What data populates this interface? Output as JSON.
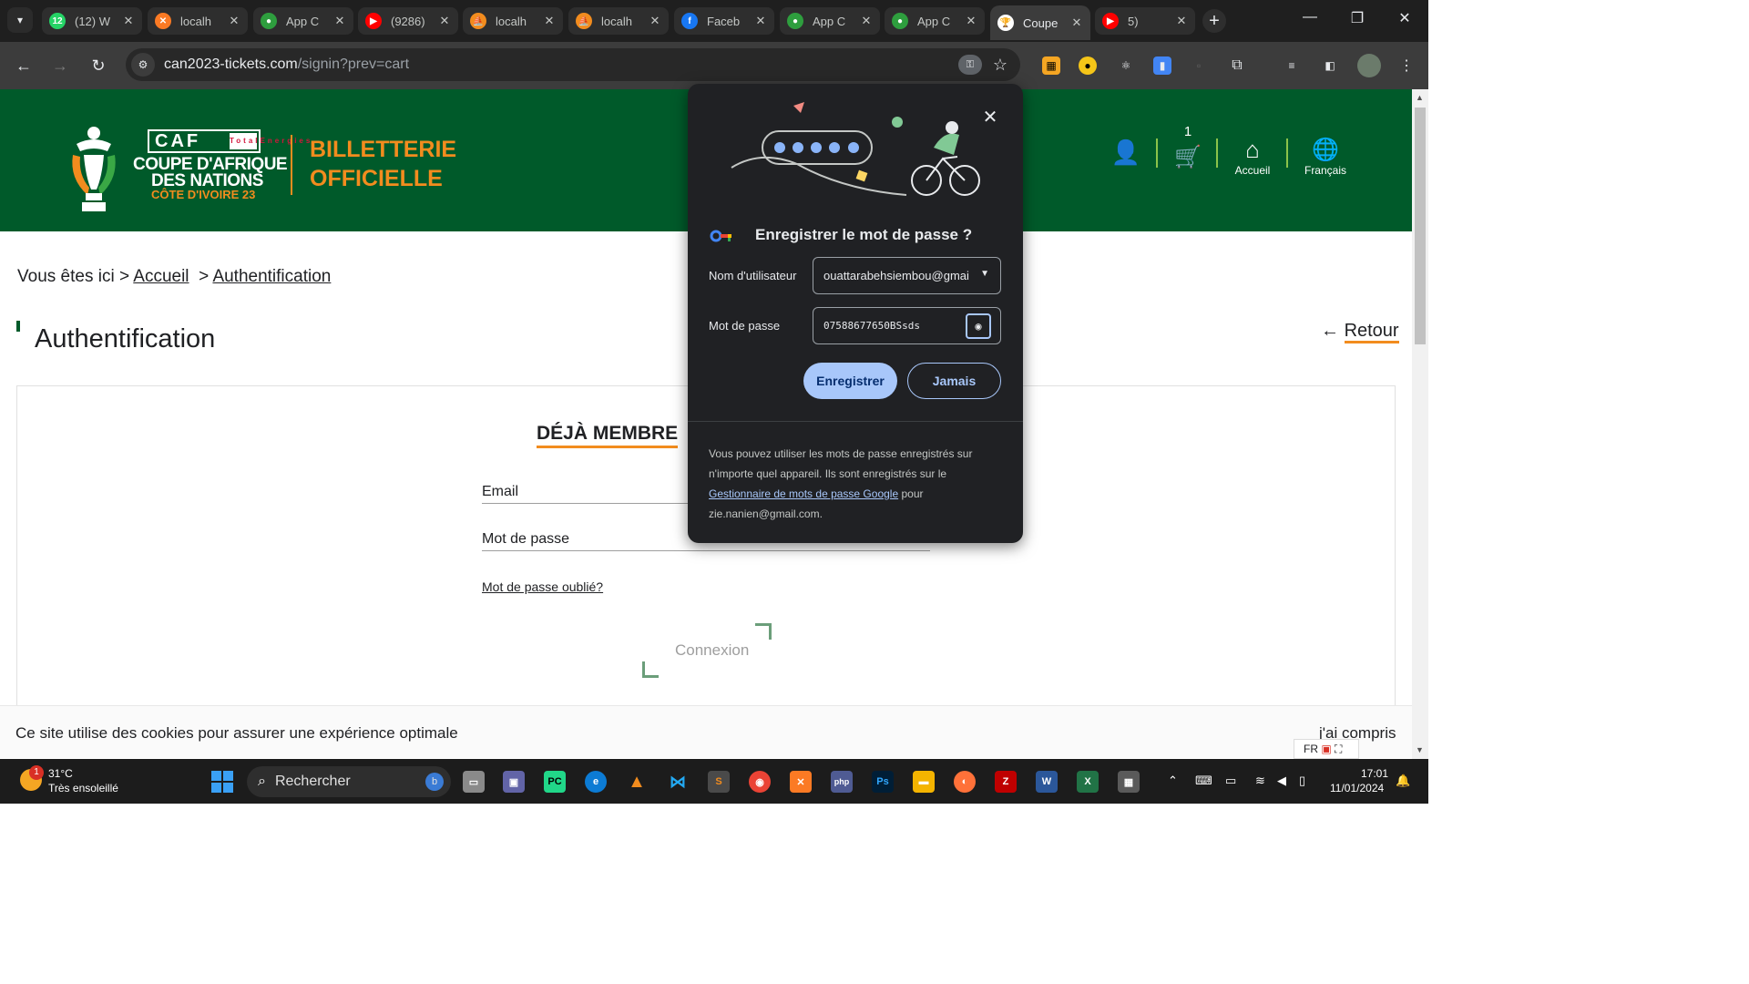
{
  "browser": {
    "tabs": [
      {
        "title": "(12) W",
        "favicon": "whatsapp-icon",
        "color": "#25d366",
        "glyph": "12"
      },
      {
        "title": "localh",
        "favicon": "xampp-icon",
        "color": "#fb7a24",
        "glyph": "✕"
      },
      {
        "title": "App C",
        "favicon": "app-globe-icon",
        "color": "#2e9e3e",
        "glyph": "●"
      },
      {
        "title": "(9286)",
        "favicon": "youtube-icon",
        "color": "#ff0000",
        "glyph": "▶"
      },
      {
        "title": "localh",
        "favicon": "sail-icon",
        "color": "#f28c1e",
        "glyph": "⛵"
      },
      {
        "title": "localh",
        "favicon": "sail-icon",
        "color": "#f28c1e",
        "glyph": "⛵"
      },
      {
        "title": "Faceb",
        "favicon": "facebook-icon",
        "color": "#1877f2",
        "glyph": "f"
      },
      {
        "title": "App C",
        "favicon": "app-globe-icon",
        "color": "#2e9e3e",
        "glyph": "●"
      },
      {
        "title": "App C",
        "favicon": "app-globe-icon",
        "color": "#2e9e3e",
        "glyph": "●"
      },
      {
        "title": "Coupe",
        "favicon": "can-trophy-icon",
        "color": "#ffffff",
        "glyph": "🏆"
      },
      {
        "title": "5)",
        "favicon": "youtube-icon",
        "color": "#ff0000",
        "glyph": "▶"
      }
    ],
    "active_tab_index": 9,
    "url_host": "can2023-tickets.com",
    "url_path": "/signin?prev=cart"
  },
  "header": {
    "caf": "CAF",
    "sponsor": "TotalEnergies",
    "logo_line1": "COUPE D'AFRIQUE",
    "logo_line2": "DES NATIONS",
    "logo_line3": "CÔTE D'IVOIRE 23",
    "billet_line1": "BILLETTERIE",
    "billet_line2": "OFFICIELLE",
    "cart_count": "1",
    "home_label": "Accueil",
    "lang_label": "Français"
  },
  "page": {
    "breadcrumb_prefix": "Vous êtes ici >",
    "breadcrumb_home": "Accueil",
    "breadcrumb_sep": ">",
    "breadcrumb_current": "Authentification",
    "title": "Authentification",
    "back": "Retour",
    "section_title": "DÉJÀ MEMBRE",
    "email_label": "Email",
    "password_label": "Mot de passe",
    "forgot": "Mot de passe oublié?",
    "login": "Connexion"
  },
  "cookie": {
    "message": "Ce site utilise des cookies pour assurer une expérience optimale",
    "accept": "j'ai compris",
    "lang_badge": "FR"
  },
  "password_popup": {
    "title": "Enregistrer le mot de passe ?",
    "username_label": "Nom d'utilisateur",
    "username_value": "ouattarabehsiembou@gmai",
    "password_label": "Mot de passe",
    "password_value": "07588677650BSsds",
    "save": "Enregistrer",
    "never": "Jamais",
    "footer_text1": "Vous pouvez utiliser les mots de passe enregistrés sur n'importe quel appareil. Ils sont enregistrés sur le",
    "footer_link": "Gestionnaire de mots de passe Google",
    "footer_text2": "pour zie.nanien@gmail.com."
  },
  "taskbar": {
    "weather_badge": "1",
    "temperature": "31°C",
    "weather": "Très ensoleillé",
    "search_placeholder": "Rechercher",
    "lang": "FR",
    "time": "17:01",
    "date": "11/01/2024"
  }
}
